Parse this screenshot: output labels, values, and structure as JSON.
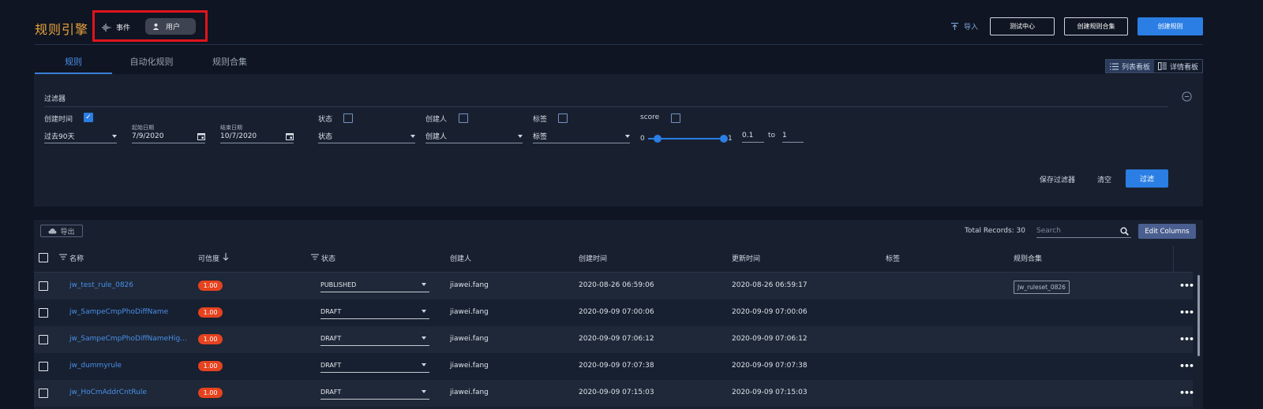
{
  "header": {
    "title": "规则引擎",
    "mode_events": "事件",
    "mode_users": "用户",
    "import_label": "导入",
    "btn_test_center": "测试中心",
    "btn_create_ruleset": "创建规则合集",
    "btn_create_rule": "创建规则"
  },
  "tabs": [
    "规则",
    "自动化规则",
    "规则合集"
  ],
  "view_toggle": {
    "list": "列表看板",
    "detail": "详情看板"
  },
  "filter": {
    "title": "过滤器",
    "created_time_label": "创建时间",
    "created_time_checked": true,
    "range_value": "过去90天",
    "start_date_label": "起始日期",
    "start_date": "7/9/2020",
    "end_date_label": "结束日期",
    "end_date": "10/7/2020",
    "status_label": "状态",
    "status_value": "状态",
    "creator_label": "创建人",
    "creator_value": "创建人",
    "tag_label": "标签",
    "tag_value": "标签",
    "score_label": "score",
    "score_min_label": "0",
    "score_max_label": "1",
    "score_from": "0.1",
    "score_to_word": "to",
    "score_to": "1",
    "save_label": "保存过滤器",
    "clear_label": "清空",
    "apply_label": "过滤"
  },
  "table": {
    "export_label": "导出",
    "total_records": "Total Records: 30",
    "search_placeholder": "Search",
    "edit_columns": "Edit Columns",
    "columns": {
      "name": "名称",
      "confidence": "可信度",
      "status": "状态",
      "creator": "创建人",
      "created": "创建时间",
      "updated": "更新时间",
      "tags": "标签",
      "ruleset": "规则合集"
    },
    "rows": [
      {
        "name": "jw_test_rule_0826",
        "confidence": "1.00",
        "status": "PUBLISHED",
        "creator": "jiawei.fang",
        "created": "2020-08-26 06:59:06",
        "updated": "2020-08-26 06:59:17",
        "ruleset": "Jw_ruleset_0826"
      },
      {
        "name": "jw_SampeCmpPhoDiffName",
        "confidence": "1.00",
        "status": "DRAFT",
        "creator": "jiawei.fang",
        "created": "2020-09-09 07:00:06",
        "updated": "2020-09-09 07:00:06",
        "ruleset": ""
      },
      {
        "name": "jw_SampeCmpPhoDiffNameHig...",
        "confidence": "1.00",
        "status": "DRAFT",
        "creator": "jiawei.fang",
        "created": "2020-09-09 07:06:12",
        "updated": "2020-09-09 07:06:12",
        "ruleset": ""
      },
      {
        "name": "jw_dummyrule",
        "confidence": "1.00",
        "status": "DRAFT",
        "creator": "jiawei.fang",
        "created": "2020-09-09 07:07:38",
        "updated": "2020-09-09 07:07:38",
        "ruleset": ""
      },
      {
        "name": "jw_HoCmAddrCntRule",
        "confidence": "1.00",
        "status": "DRAFT",
        "creator": "jiawei.fang",
        "created": "2020-09-09 07:15:03",
        "updated": "2020-09-09 07:15:03",
        "ruleset": ""
      }
    ]
  },
  "colors": {
    "accent": "#2b7ee4",
    "title": "#e8a33d",
    "highlight_box": "#e1141c",
    "badge": "#e5431f"
  }
}
